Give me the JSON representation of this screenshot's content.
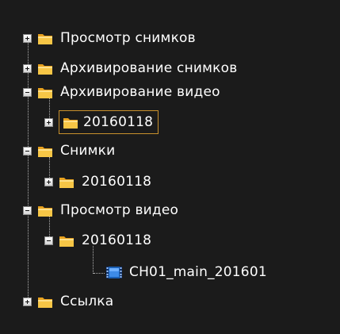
{
  "tree": {
    "items": [
      {
        "label": "Просмотр снимков",
        "state": "collapsed"
      },
      {
        "label": "Архивирование снимков",
        "state": "collapsed"
      },
      {
        "label": "Архивирование видео",
        "state": "expanded"
      },
      {
        "label": "20160118",
        "state": "collapsed",
        "selected": true
      },
      {
        "label": "Снимки",
        "state": "expanded"
      },
      {
        "label": "20160118",
        "state": "collapsed"
      },
      {
        "label": "Просмотр видео",
        "state": "expanded"
      },
      {
        "label": "20160118",
        "state": "expanded"
      },
      {
        "label": "CH01_main_201601",
        "type": "video-file"
      },
      {
        "label": "Ссылка",
        "state": "collapsed"
      }
    ]
  },
  "colors": {
    "background": "#1b1b1b",
    "selection_border": "#c8902c",
    "folder": "#f5b82e"
  }
}
